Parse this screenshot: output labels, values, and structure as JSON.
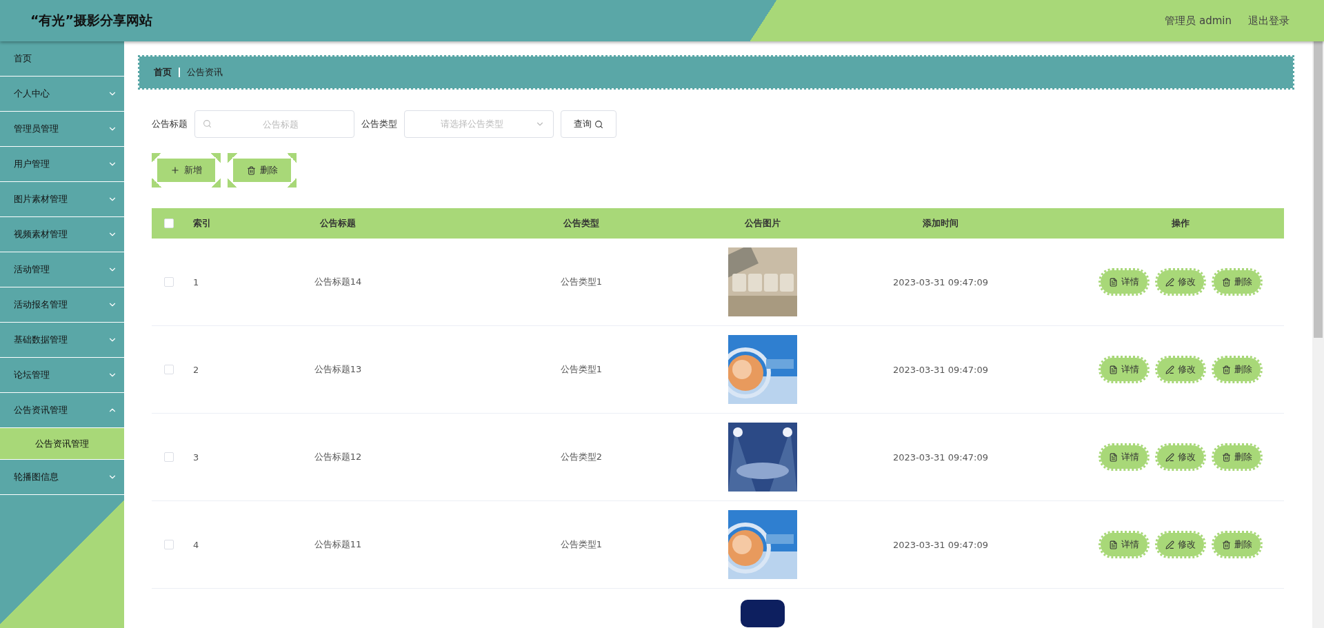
{
  "header": {
    "title": "“有光”摄影分享网站",
    "user": "管理员 admin",
    "logout": "退出登录"
  },
  "sidebar": {
    "items": [
      {
        "label": "首页",
        "kind": "link"
      },
      {
        "label": "个人中心",
        "kind": "group",
        "expanded": false
      },
      {
        "label": "管理员管理",
        "kind": "group",
        "expanded": false
      },
      {
        "label": "用户管理",
        "kind": "group",
        "expanded": false
      },
      {
        "label": "图片素材管理",
        "kind": "group",
        "expanded": false
      },
      {
        "label": "视频素材管理",
        "kind": "group",
        "expanded": false
      },
      {
        "label": "活动管理",
        "kind": "group",
        "expanded": false
      },
      {
        "label": "活动报名管理",
        "kind": "group",
        "expanded": false
      },
      {
        "label": "基础数据管理",
        "kind": "group",
        "expanded": false
      },
      {
        "label": "论坛管理",
        "kind": "group",
        "expanded": false
      },
      {
        "label": "公告资讯管理",
        "kind": "group",
        "expanded": true,
        "children": [
          {
            "label": "公告资讯管理",
            "selected": true
          }
        ]
      },
      {
        "label": "轮播图信息",
        "kind": "group",
        "expanded": false
      }
    ]
  },
  "breadcrumb": [
    "首页",
    "公告资讯"
  ],
  "search": {
    "title_label": "公告标题",
    "title_placeholder": "公告标题",
    "type_label": "公告类型",
    "type_placeholder": "请选择公告类型",
    "button": "查询"
  },
  "actions": {
    "add": "新增",
    "delete": "删除"
  },
  "table": {
    "columns": [
      "索引",
      "公告标题",
      "公告类型",
      "公告图片",
      "添加时间",
      "操作"
    ],
    "all_checked": false,
    "rows": [
      {
        "checked": false,
        "index": "1",
        "title": "公告标题14",
        "type": "公告类型1",
        "image": {
          "kind": "picture"
        },
        "time": "2023-03-31 09:47:09",
        "buttons": [
          "详情",
          "修改",
          "删除"
        ]
      },
      {
        "checked": false,
        "index": "2",
        "title": "公告标题13",
        "type": "公告类型1",
        "image": {
          "kind": "picture"
        },
        "time": "2023-03-31 09:47:09",
        "buttons": [
          "详情",
          "修改",
          "删除"
        ]
      },
      {
        "checked": false,
        "index": "3",
        "title": "公告标题12",
        "type": "公告类型2",
        "image": {
          "kind": "picture"
        },
        "time": "2023-03-31 09:47:09",
        "buttons": [
          "详情",
          "修改",
          "删除"
        ]
      },
      {
        "checked": false,
        "index": "4",
        "title": "公告标题11",
        "type": "公告类型1",
        "image": {
          "kind": "picture"
        },
        "time": "2023-03-31 09:47:09",
        "buttons": [
          "详情",
          "修改",
          "删除"
        ]
      }
    ],
    "cut_row": {
      "image": {
        "kind": "picture"
      }
    }
  }
}
